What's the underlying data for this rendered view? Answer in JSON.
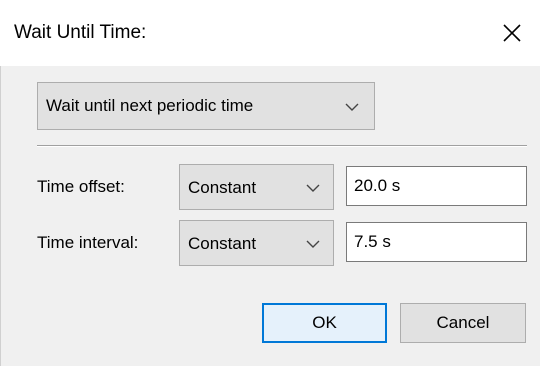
{
  "window": {
    "title": "Wait Until Time:",
    "close_icon": "close-icon"
  },
  "mode": {
    "selected": "Wait until next periodic time"
  },
  "offset": {
    "label": "Time offset:",
    "type": "Constant",
    "value": "20.0 s"
  },
  "interval": {
    "label": "Time interval:",
    "type": "Constant",
    "value": "7.5 s"
  },
  "buttons": {
    "ok": "OK",
    "cancel": "Cancel"
  },
  "colors": {
    "content_bg": "#f0f0f0",
    "button_bg": "#e1e1e1",
    "default_button_border": "#0078d7",
    "default_button_bg": "#e5f1fb"
  }
}
